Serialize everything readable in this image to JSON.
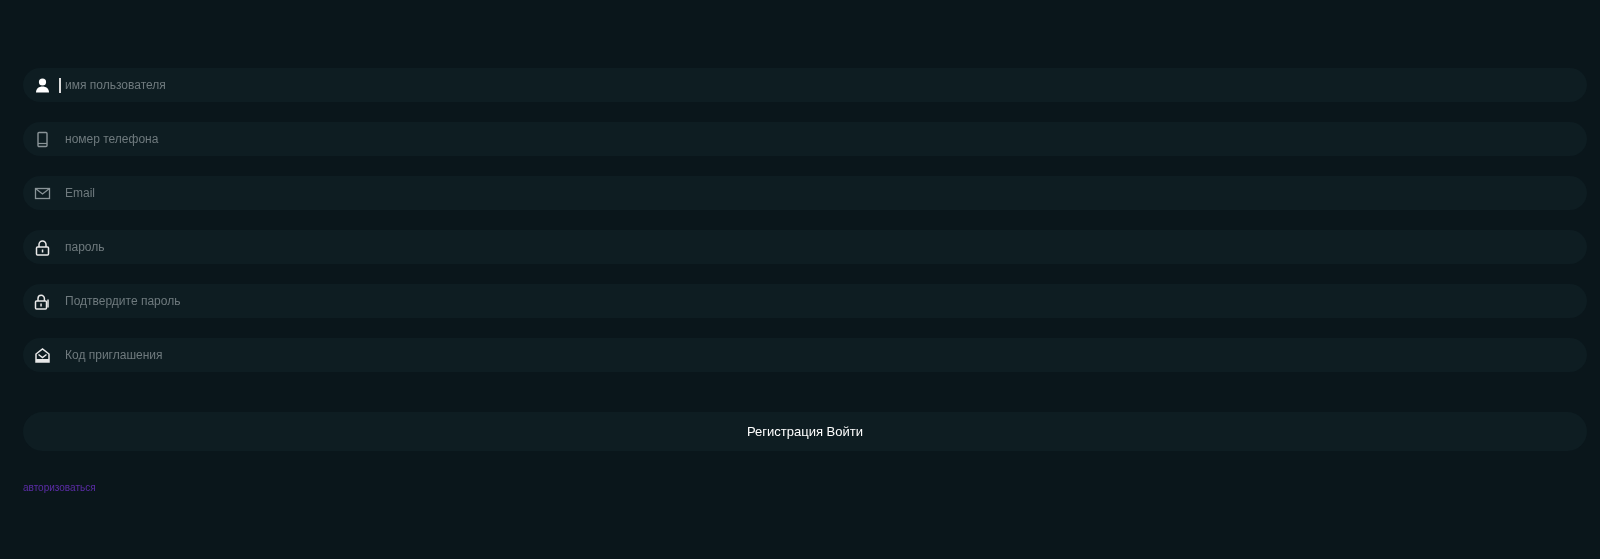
{
  "fields": [
    {
      "kind": "user",
      "placeholder": "имя пользователя",
      "focused": true
    },
    {
      "kind": "phone",
      "placeholder": "номер телефона",
      "focused": false
    },
    {
      "kind": "mail",
      "placeholder": "Email",
      "focused": false
    },
    {
      "kind": "lock",
      "placeholder": "пароль",
      "focused": false
    },
    {
      "kind": "locks",
      "placeholder": "Подтвердите пароль",
      "focused": false
    },
    {
      "kind": "inbox",
      "placeholder": "Код приглашения",
      "focused": false
    }
  ],
  "submit": {
    "label": "Регистрация Войти"
  },
  "login_link": {
    "label": "авторизоваться"
  }
}
